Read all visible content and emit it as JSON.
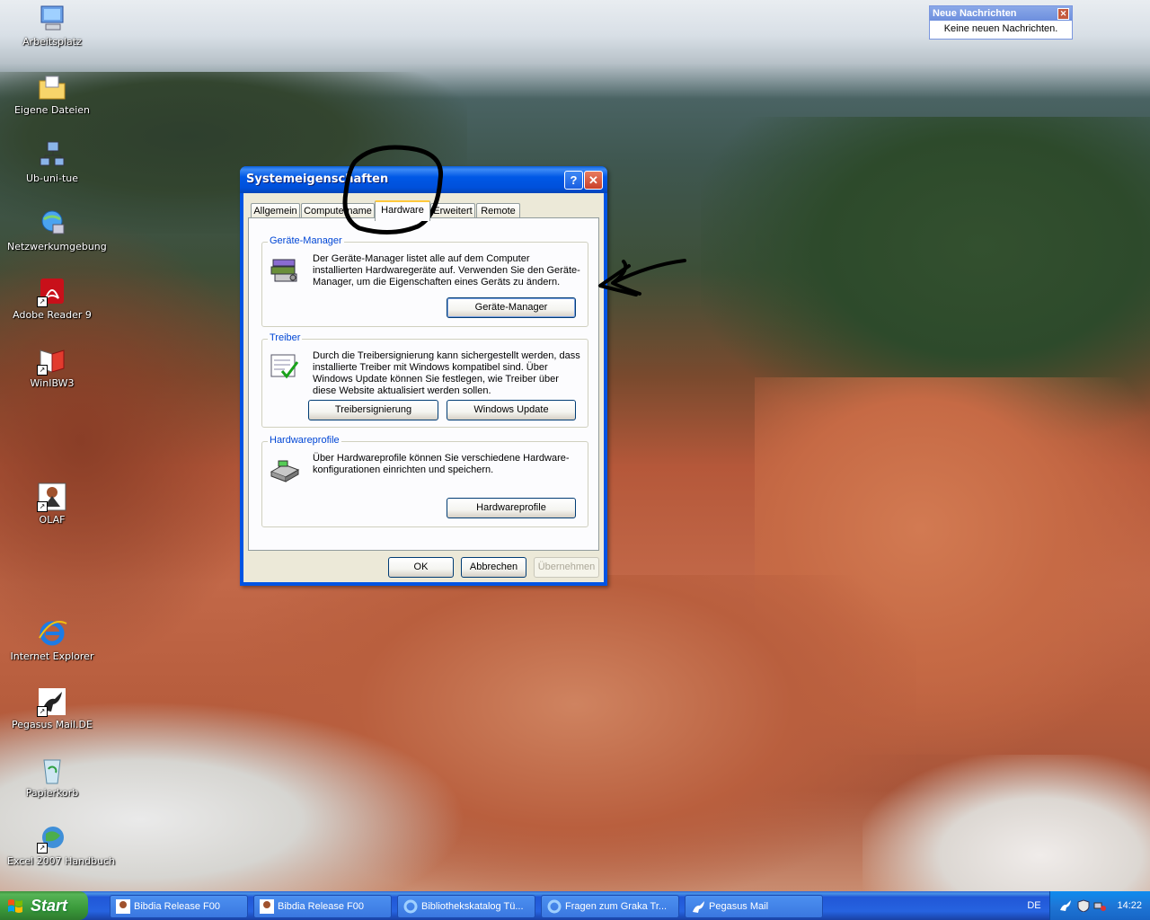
{
  "desktop_icons": [
    {
      "label": "Arbeitsplatz",
      "icon": "my-computer-icon"
    },
    {
      "label": "Eigene Dateien",
      "icon": "my-documents-icon"
    },
    {
      "label": "Ub-uni-tue",
      "icon": "network-drive-icon"
    },
    {
      "label": "Netzwerkumgebung",
      "icon": "network-places-icon"
    },
    {
      "label": "Adobe Reader 9",
      "icon": "adobe-reader-icon"
    },
    {
      "label": "WinIBW3",
      "icon": "winibw-icon"
    },
    {
      "label": "OLAF",
      "icon": "olaf-icon"
    },
    {
      "label": "Internet Explorer",
      "icon": "internet-explorer-icon"
    },
    {
      "label": "Pegasus Mail.DE",
      "icon": "pegasus-mail-icon"
    },
    {
      "label": "Papierkorb",
      "icon": "recycle-bin-icon"
    },
    {
      "label": "Excel 2007 Handbuch",
      "icon": "excel-handbook-icon"
    }
  ],
  "notification": {
    "title": "Neue Nachrichten",
    "message": "Keine neuen Nachrichten."
  },
  "dialog": {
    "title": "Systemeigenschaften",
    "help_button": "?",
    "close_button": "✕",
    "tabs": [
      "Allgemein",
      "Computername",
      "Hardware",
      "Erweitert",
      "Remote"
    ],
    "active_tab": "Hardware",
    "groups": {
      "device_manager": {
        "title": "Geräte-Manager",
        "text": "Der Geräte-Manager listet alle auf dem Computer installierten Hardwaregeräte auf. Verwenden Sie den Geräte-Manager, um die Eigenschaften eines Geräts zu ändern.",
        "button": "Geräte-Manager"
      },
      "drivers": {
        "title": "Treiber",
        "text": "Durch die Treibersignierung kann sichergestellt werden, dass installierte Treiber mit Windows kompatibel sind. Über Windows Update können Sie festlegen, wie Treiber über diese Website aktualisiert werden sollen.",
        "button_signing": "Treibersignierung",
        "button_update": "Windows Update"
      },
      "hardware_profiles": {
        "title": "Hardwareprofile",
        "text": "Über Hardwareprofile können Sie verschiedene Hardware-konfigurationen einrichten und speichern.",
        "button": "Hardwareprofile"
      }
    },
    "buttons": {
      "ok": "OK",
      "cancel": "Abbrechen",
      "apply": "Übernehmen"
    }
  },
  "taskbar": {
    "start_label": "Start",
    "tasks": [
      {
        "label": "Bibdia Release F00",
        "icon": "bibdia-icon"
      },
      {
        "label": "Bibdia Release F00",
        "icon": "bibdia-icon"
      },
      {
        "label": "Bibliothekskatalog Tü...",
        "icon": "internet-explorer-icon"
      },
      {
        "label": "Fragen zum Graka Tr...",
        "icon": "internet-explorer-icon"
      },
      {
        "label": "Pegasus Mail",
        "icon": "pegasus-mail-icon"
      }
    ],
    "language": "DE",
    "clock": "14:22"
  },
  "colors": {
    "xp_blue": "#0054e3",
    "dialog_face": "#ece9d8",
    "group_title": "#0046d5",
    "start_green": "#3a9a3a"
  }
}
